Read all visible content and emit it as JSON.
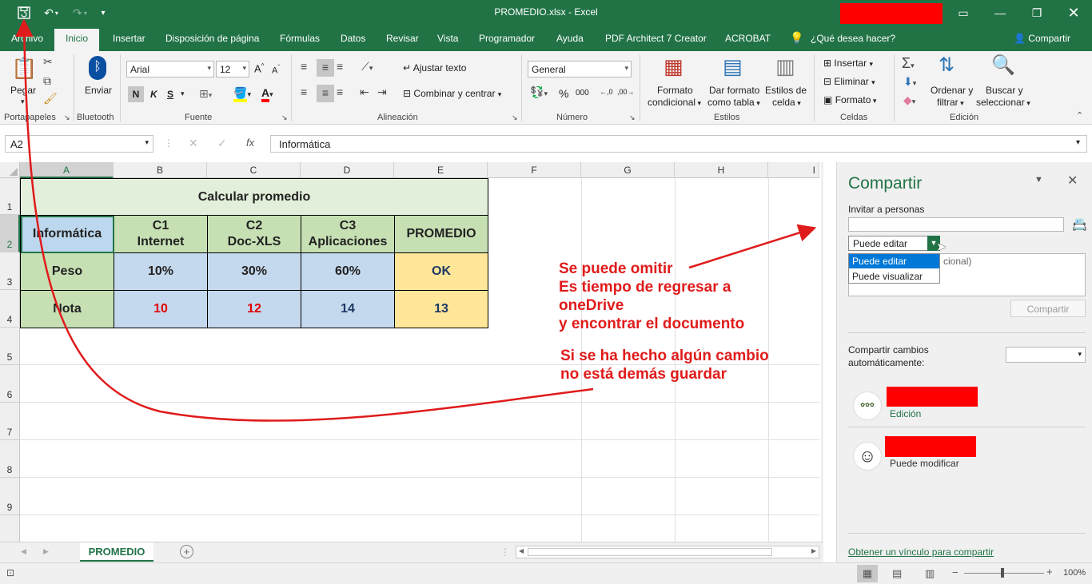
{
  "window": {
    "title": "PROMEDIO.xlsx  -  Excel"
  },
  "tabs": [
    "Archivo",
    "Inicio",
    "Insertar",
    "Disposición de página",
    "Fórmulas",
    "Datos",
    "Revisar",
    "Vista",
    "Programador",
    "Ayuda",
    "PDF Architect 7 Creator",
    "ACROBAT"
  ],
  "tell_me": "¿Qué desea hacer?",
  "share_button": "Compartir",
  "ribbon": {
    "paste": "Pegar",
    "clipboard_label": "Portapapeles",
    "bluetooth_send": "Enviar",
    "bluetooth_label": "Bluetooth",
    "font_name": "Arial",
    "font_size": "12",
    "bold": "N",
    "italic": "K",
    "underline": "S",
    "font_label": "Fuente",
    "wrap_text": "Ajustar texto",
    "merge_center": "Combinar y centrar",
    "alignment_label": "Alineación",
    "number_format": "General",
    "percent": "%",
    "thousands": "000",
    "number_label": "Número",
    "cond_format_1": "Formato",
    "cond_format_2": "condicional",
    "table_format_1": "Dar formato",
    "table_format_2": "como tabla",
    "cell_styles_1": "Estilos de",
    "cell_styles_2": "celda",
    "styles_label": "Estilos",
    "insert": "Insertar",
    "delete": "Eliminar",
    "format": "Formato",
    "cells_label": "Celdas",
    "sort_1": "Ordenar y",
    "sort_2": "filtrar",
    "find_1": "Buscar y",
    "find_2": "seleccionar",
    "editing_label": "Edición"
  },
  "formula_bar": {
    "name_box": "A2",
    "content": "Informática",
    "fx": "fx"
  },
  "columns": [
    "A",
    "B",
    "C",
    "D",
    "E",
    "F",
    "G",
    "H",
    "I"
  ],
  "rows": [
    "1",
    "2",
    "3",
    "4",
    "5",
    "6",
    "7",
    "8",
    "9"
  ],
  "table": {
    "title": "Calcular promedio",
    "header": [
      "Informática",
      "C1\nInternet",
      "C2\nDoc-XLS",
      "C3\nAplicaciones",
      "PROMEDIO"
    ],
    "weight_row": [
      "Peso",
      "10%",
      "30%",
      "60%",
      "OK"
    ],
    "grade_row": [
      "Nota",
      "10",
      "12",
      "14",
      "13"
    ],
    "colors": {
      "title_bg": "#e2efda",
      "col_a_bg": "#c6e0b4",
      "selected_bg": "#bdd7ee",
      "blue_bg": "#c4d9ee",
      "e_header_bg": "#c6e0b4",
      "e_bg": "#ffe699",
      "red_text": "#e00000",
      "navy_text": "#1f3864"
    }
  },
  "sheet_tab": "PROMEDIO",
  "status": {
    "zoom": "100%"
  },
  "share_pane": {
    "title": "Compartir",
    "invite_label": "Invitar a personas",
    "permission_selected": "Puede editar",
    "permission_options": [
      "Puede editar",
      "Puede visualizar"
    ],
    "message_placeholder_partial": "cional)",
    "share_button": "Compartir",
    "auto_share_label_1": "Compartir cambios",
    "auto_share_label_2": "automáticamente:",
    "user1_role": "Edición",
    "user2_role": "Puede modificar",
    "get_link": "Obtener un vínculo para compartir"
  },
  "annotations": {
    "note1": [
      "Se puede omitir",
      "Es tiempo de regresar a",
      "oneDrive",
      "y encontrar el documento"
    ],
    "note2": [
      "Si se ha hecho algún cambio",
      "no está demás guardar"
    ],
    "color": "#e01b1b"
  }
}
